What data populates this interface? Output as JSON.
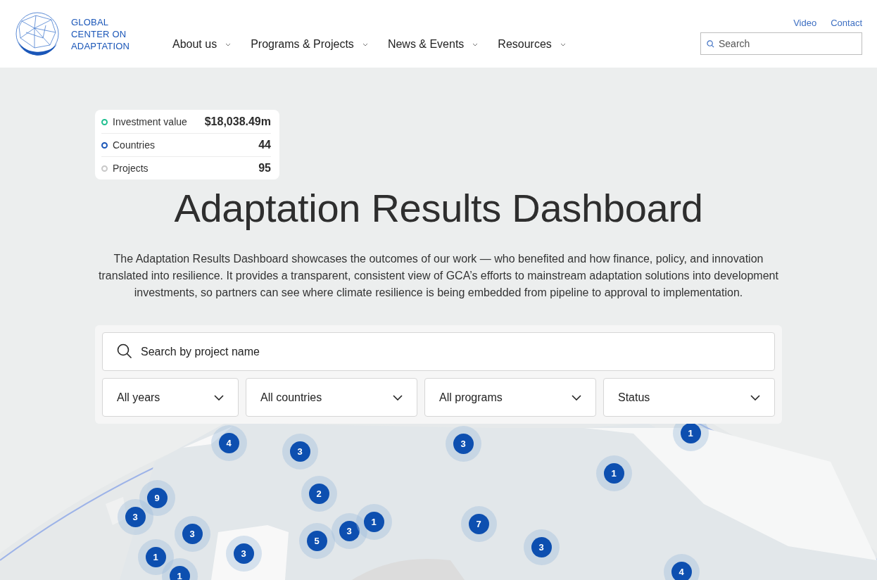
{
  "logo": {
    "lines": [
      "GLOBAL",
      "CENTER ON",
      "ADAPTATION"
    ]
  },
  "nav": [
    {
      "label": "About us"
    },
    {
      "label": "Programs & Projects"
    },
    {
      "label": "News & Events"
    },
    {
      "label": "Resources"
    }
  ],
  "utility_links": [
    "Video",
    "Contact"
  ],
  "header_search": {
    "placeholder": "Search"
  },
  "stats": [
    {
      "label": "Investment value",
      "value": "$18,038.49m",
      "color": "#1fbf8f"
    },
    {
      "label": "Countries",
      "value": "44",
      "color": "#1a56b8"
    },
    {
      "label": "Projects",
      "value": "95",
      "color": "#c8c8c8"
    }
  ],
  "title": "Adaptation Results Dashboard",
  "description": "The Adaptation Results Dashboard showcases the outcomes of our work — who benefited and how finance, policy, and innovation translated into resilience. It provides a transparent, consistent view of GCA’s efforts to mainstream adaptation solutions into development investments, so partners can see where climate resilience is being embedded from pipeline to approval to implementation.",
  "project_search": {
    "placeholder": "Search by project name"
  },
  "filters": [
    {
      "label": "All years"
    },
    {
      "label": "All countries"
    },
    {
      "label": "All programs"
    },
    {
      "label": "Status"
    }
  ],
  "map": {
    "kind": "picture",
    "clusters": [
      "4",
      "3",
      "9",
      "3",
      "3",
      "1",
      "1",
      "3",
      "2",
      "5",
      "3",
      "1",
      "3",
      "1",
      "1",
      "7",
      "3",
      "4"
    ]
  }
}
